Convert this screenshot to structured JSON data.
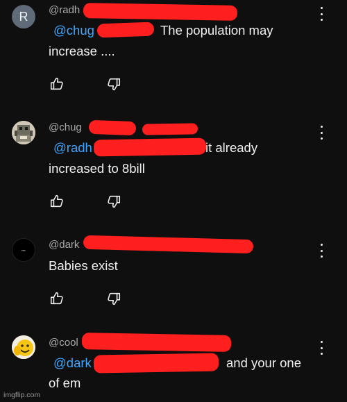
{
  "comments": [
    {
      "avatar_letter": "R",
      "handle": "@radh",
      "mention": "@chug",
      "text": "The population may",
      "text_line2": "increase ....",
      "like_icon": "thumbs-up-icon",
      "dislike_icon": "thumbs-down-icon",
      "menu_icon": "more-vertical-icon"
    },
    {
      "avatar_image": "pixel-art-creature",
      "handle": "@chug",
      "mention": "@radh",
      "text": "it already",
      "text_line2": "increased to 8bill",
      "like_icon": "thumbs-up-icon",
      "dislike_icon": "thumbs-down-icon",
      "menu_icon": "more-vertical-icon"
    },
    {
      "avatar_image": "black-logo",
      "handle": "@dark",
      "text": "Babies exist",
      "like_icon": "thumbs-up-icon",
      "dislike_icon": "thumbs-down-icon",
      "menu_icon": "more-vertical-icon"
    },
    {
      "avatar_image": "smiling-emoji",
      "handle": "@cool",
      "mention": "@dark",
      "text": "and your one",
      "text_line2": "of em",
      "menu_icon": "more-vertical-icon"
    }
  ],
  "watermark": "imgflip.com",
  "colors": {
    "background": "#0f0f0f",
    "text": "#f1f1f1",
    "handle": "#aaaaaa",
    "mention": "#3ea6ff",
    "redaction": "#ff1f1f"
  }
}
